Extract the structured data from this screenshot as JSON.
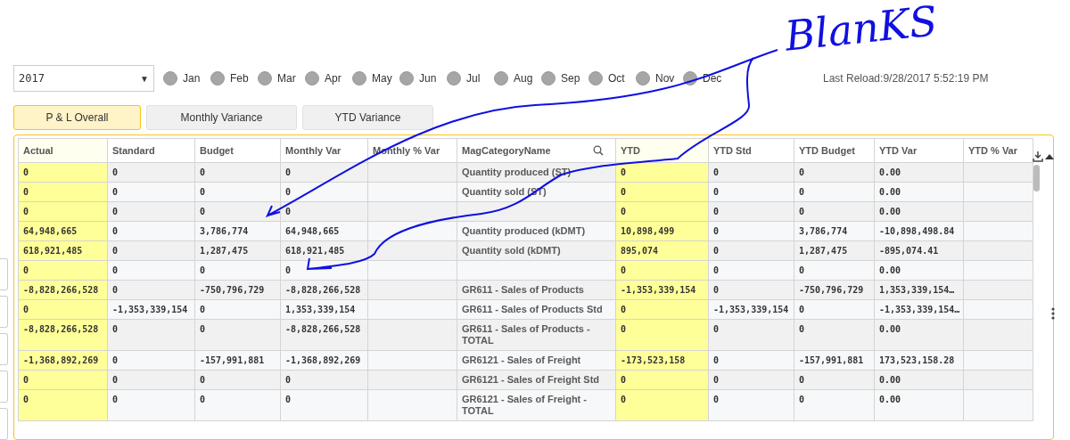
{
  "year_select": {
    "value": "2017",
    "caret": "▼"
  },
  "months": [
    {
      "label": "Jan",
      "selected": false
    },
    {
      "label": "Feb",
      "selected": false
    },
    {
      "label": "Mar",
      "selected": false
    },
    {
      "label": "Apr",
      "selected": false
    },
    {
      "label": "May",
      "selected": false
    },
    {
      "label": "Jun",
      "selected": false
    },
    {
      "label": "Jul",
      "selected": false
    },
    {
      "label": "Aug",
      "selected": false
    },
    {
      "label": "Sep",
      "selected": false
    },
    {
      "label": "Oct",
      "selected": false
    },
    {
      "label": "Nov",
      "selected": false
    },
    {
      "label": "Dec",
      "selected": false
    }
  ],
  "last_reload": "Last Reload:9/28/2017 5:52:19 PM",
  "tabs": [
    {
      "label": "P & L Overall",
      "selected": true
    },
    {
      "label": "Monthly Variance",
      "selected": false
    },
    {
      "label": "YTD Variance",
      "selected": false
    }
  ],
  "table": {
    "columns": [
      {
        "label": "Actual",
        "highlighted": true,
        "kind": "number"
      },
      {
        "label": "Standard",
        "highlighted": false,
        "kind": "number"
      },
      {
        "label": "Budget",
        "highlighted": false,
        "kind": "number"
      },
      {
        "label": "Monthly Var",
        "highlighted": false,
        "kind": "number"
      },
      {
        "label": "Monthly % Var",
        "highlighted": false,
        "kind": "number"
      },
      {
        "label": "MagCategoryName",
        "highlighted": false,
        "kind": "text",
        "searchable": true
      },
      {
        "label": "YTD",
        "highlighted": true,
        "kind": "number"
      },
      {
        "label": "YTD Std",
        "highlighted": false,
        "kind": "number"
      },
      {
        "label": "YTD Budget",
        "highlighted": false,
        "kind": "number"
      },
      {
        "label": "YTD Var",
        "highlighted": false,
        "kind": "number"
      },
      {
        "label": "YTD % Var",
        "highlighted": false,
        "kind": "number"
      }
    ],
    "rows": [
      {
        "cells": [
          "0",
          "0",
          "0",
          "0",
          null,
          "Quantity produced (ST)",
          "0",
          "0",
          "0",
          "0.00",
          null
        ]
      },
      {
        "cells": [
          "0",
          "0",
          "0",
          "0",
          null,
          "Quantity sold (ST)",
          "0",
          "0",
          "0",
          "0.00",
          null
        ]
      },
      {
        "cells": [
          "0",
          "0",
          "0",
          "0",
          null,
          null,
          "0",
          "0",
          "0",
          "0.00",
          null
        ]
      },
      {
        "cells": [
          "64,948,665",
          "0",
          "3,786,774",
          "64,948,665",
          null,
          "Quantity produced (kDMT)",
          "10,898,499",
          "0",
          "3,786,774",
          "-10,898,498.84",
          null
        ]
      },
      {
        "cells": [
          "618,921,485",
          "0",
          "1,287,475",
          "618,921,485",
          null,
          "Quantity sold (kDMT)",
          "895,074",
          "0",
          "1,287,475",
          "-895,074.41",
          null
        ]
      },
      {
        "cells": [
          "0",
          "0",
          "0",
          "0",
          null,
          null,
          "0",
          "0",
          "0",
          "0.00",
          null
        ]
      },
      {
        "cells": [
          "-8,828,266,528",
          "0",
          "-750,796,729",
          "-8,828,266,528",
          null,
          "GR611 - Sales of Products",
          "-1,353,339,154",
          "0",
          "-750,796,729",
          "1,353,339,154…",
          null
        ]
      },
      {
        "cells": [
          "0",
          "-1,353,339,154",
          "0",
          "1,353,339,154",
          null,
          "GR611 - Sales of Products Std",
          "0",
          "-1,353,339,154",
          "0",
          "-1,353,339,154…",
          null
        ]
      },
      {
        "cells": [
          "-8,828,266,528",
          "0",
          "0",
          "-8,828,266,528",
          null,
          "GR611 - Sales of Products - TOTAL",
          "0",
          "0",
          "0",
          "0.00",
          null
        ]
      },
      {
        "cells": [
          "-1,368,892,269",
          "0",
          "-157,991,881",
          "-1,368,892,269",
          null,
          "GR6121 - Sales of Freight",
          "-173,523,158",
          "0",
          "-157,991,881",
          "173,523,158.28",
          null
        ]
      },
      {
        "cells": [
          "0",
          "0",
          "0",
          "0",
          null,
          "GR6121 - Sales of Freight Std",
          "0",
          "0",
          "0",
          "0.00",
          null
        ]
      },
      {
        "cells": [
          "0",
          "0",
          "0",
          "0",
          null,
          "GR6121 - Sales of Freight - TOTAL",
          "0",
          "0",
          "0",
          "0.00",
          null
        ]
      }
    ]
  },
  "annotation": {
    "text": "BlanKS"
  }
}
